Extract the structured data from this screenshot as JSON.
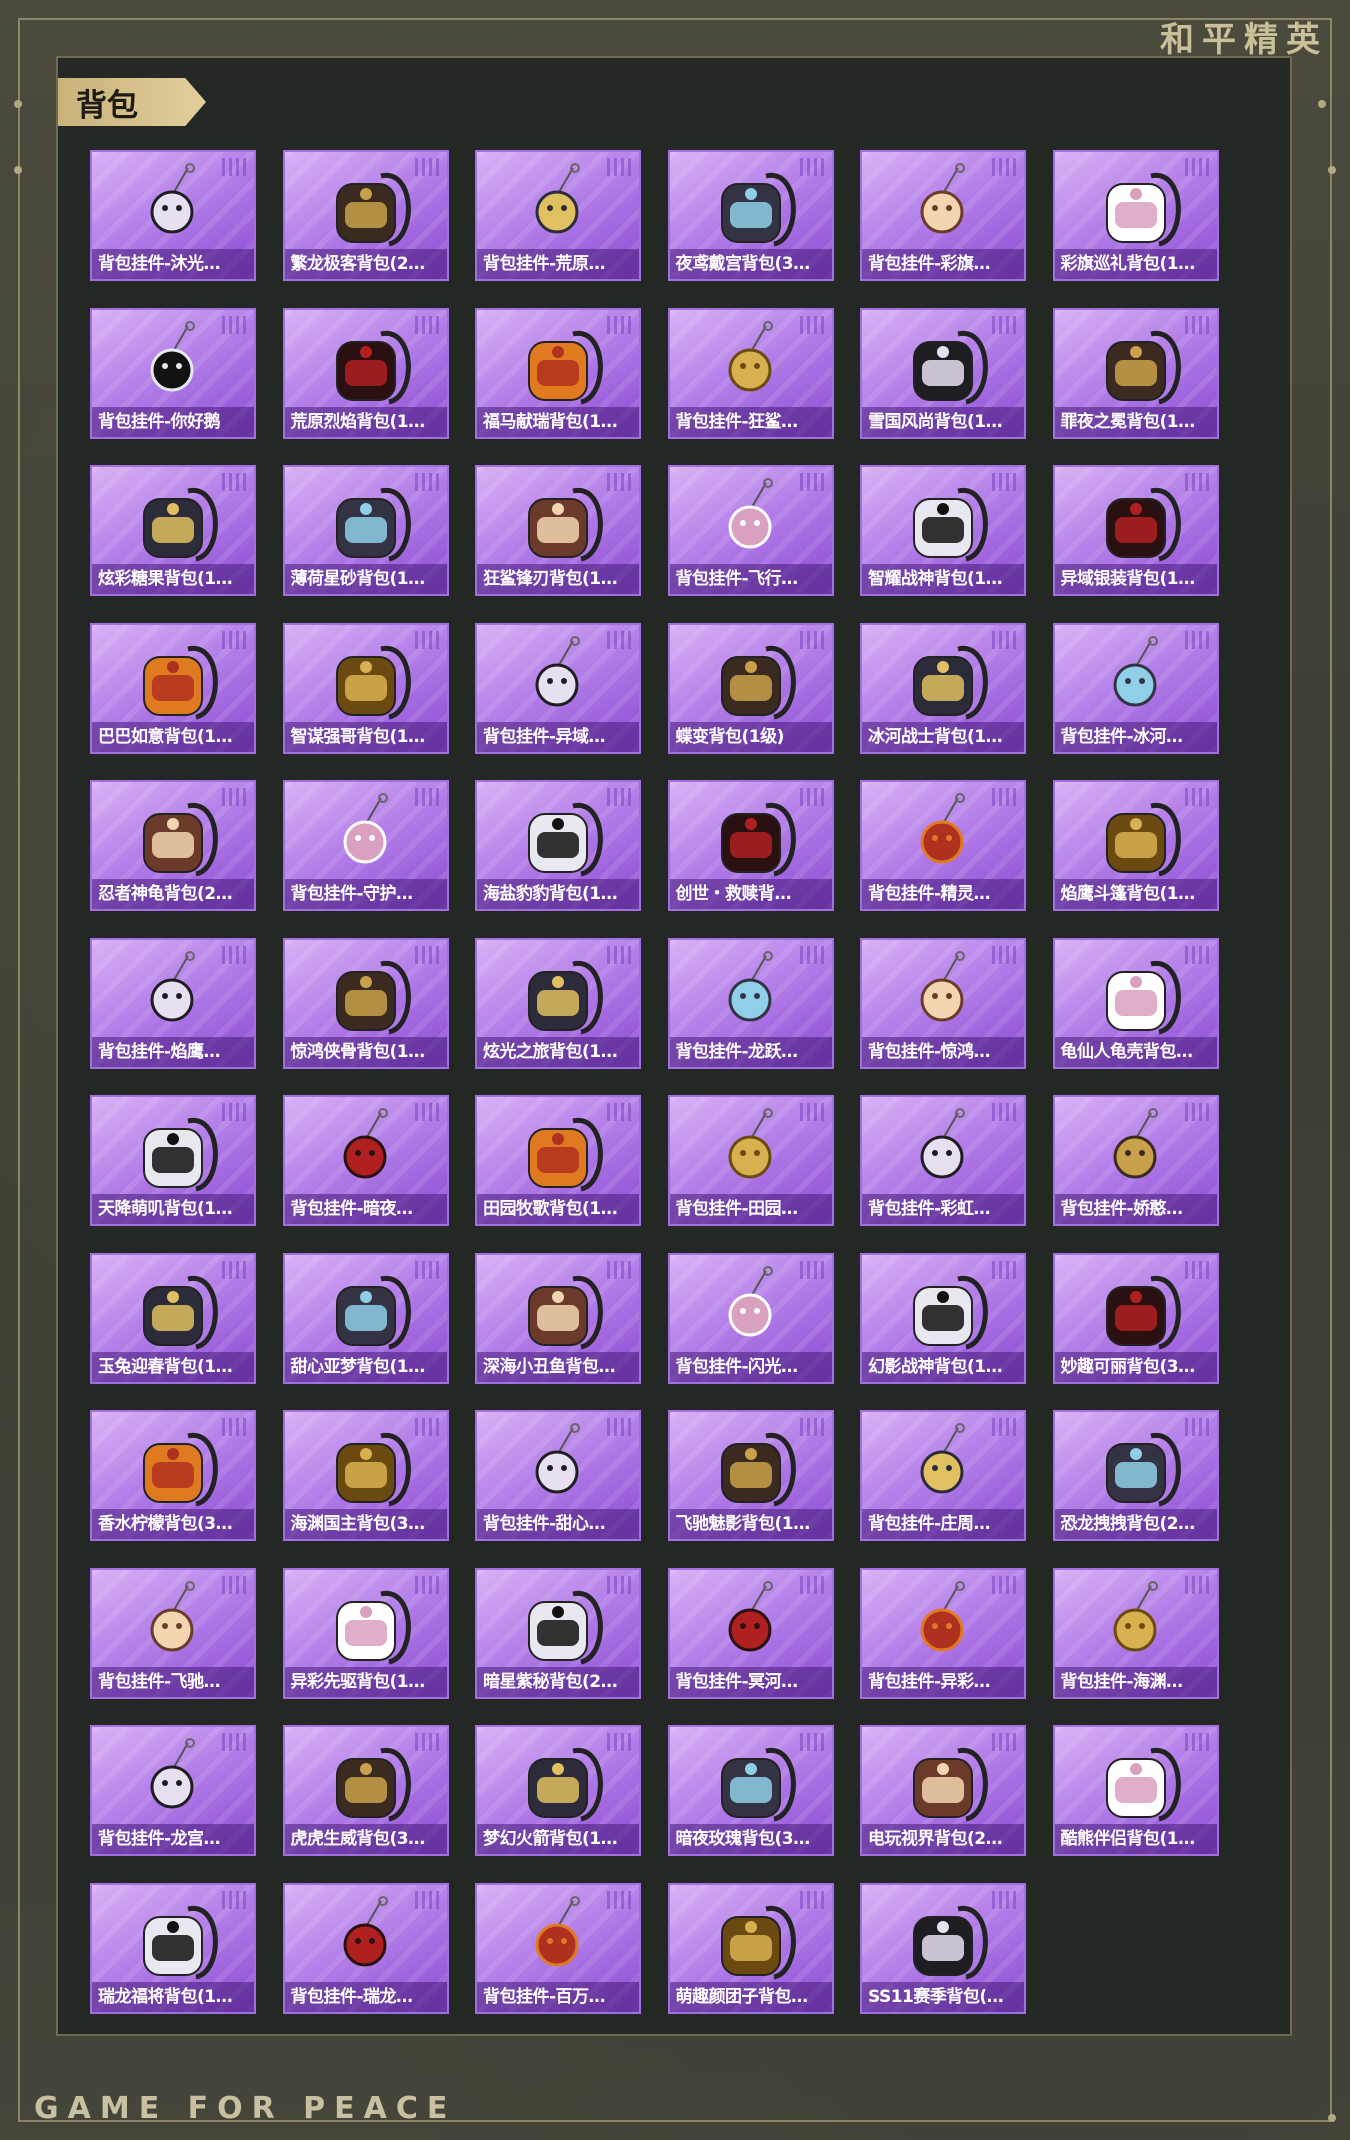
{
  "header": {
    "brand_cn": "和平精英",
    "brand_en": "GAME FOR PEACE"
  },
  "panel": {
    "title": "背包"
  },
  "colors": {
    "card_gradient_top": "#d9b2f6",
    "card_gradient_bottom": "#8d4bd3",
    "ribbon": "#c9b27a"
  },
  "items": [
    {
      "label": "背包挂件-沐光…",
      "icon": "cat-charm-icon"
    },
    {
      "label": "繁龙极客背包(2…",
      "icon": "black-gold-backpack-icon"
    },
    {
      "label": "背包挂件-荒原…",
      "icon": "star-charm-icon"
    },
    {
      "label": "夜鸢戴宫背包(3…",
      "icon": "jellyfish-backpack-icon"
    },
    {
      "label": "背包挂件-彩旗…",
      "icon": "ice-cream-charm-icon"
    },
    {
      "label": "彩旗巡礼背包(1…",
      "icon": "bunny-backpack-icon"
    },
    {
      "label": "背包挂件-你好鹅",
      "icon": "penguin-charm-icon"
    },
    {
      "label": "荒原烈焰背包(1…",
      "icon": "dark-red-backpack-icon"
    },
    {
      "label": "福马献瑞背包(1…",
      "icon": "orange-horse-backpack-icon"
    },
    {
      "label": "背包挂件-狂鲨…",
      "icon": "gold-feather-charm-icon"
    },
    {
      "label": "雪国风尚背包(1…",
      "icon": "snow-bunny-backpack-icon"
    },
    {
      "label": "罪夜之冕背包(1…",
      "icon": "black-bird-backpack-icon"
    },
    {
      "label": "炫彩糖果背包(1…",
      "icon": "donut-backpack-icon"
    },
    {
      "label": "薄荷星砂背包(1…",
      "icon": "mint-bag-icon"
    },
    {
      "label": "狂鲨锋刃背包(1…",
      "icon": "shark-backpack-icon"
    },
    {
      "label": "背包挂件-飞行…",
      "icon": "plane-charm-icon"
    },
    {
      "label": "智耀战神背包(1…",
      "icon": "rabbit-backpack-icon"
    },
    {
      "label": "异域银装背包(1…",
      "icon": "dark-case-backpack-icon"
    },
    {
      "label": "巴巴如意背包(1…",
      "icon": "white-bunny-backpack-icon"
    },
    {
      "label": "智谋强哥背包(1…",
      "icon": "bear-backpack-icon"
    },
    {
      "label": "背包挂件-异域…",
      "icon": "wing-charm-icon"
    },
    {
      "label": "蝶变背包(1级)",
      "icon": "black-bag-icon"
    },
    {
      "label": "冰河战士背包(1…",
      "icon": "blue-armor-backpack-icon"
    },
    {
      "label": "背包挂件-冰河…",
      "icon": "robot-charm-icon"
    },
    {
      "label": "忍者神龟背包(2…",
      "icon": "turtle-backpack-icon"
    },
    {
      "label": "背包挂件-守护…",
      "icon": "gem-charm-icon"
    },
    {
      "label": "海盐豹豹背包(1…",
      "icon": "seal-backpack-icon"
    },
    {
      "label": "创世・救赎背…",
      "icon": "mech-backpack-icon"
    },
    {
      "label": "背包挂件-精灵…",
      "icon": "heart-wing-charm-icon"
    },
    {
      "label": "焰鹰斗篷背包(1…",
      "icon": "red-cape-backpack-icon"
    },
    {
      "label": "背包挂件-焰鹰…",
      "icon": "knot-charm-icon"
    },
    {
      "label": "惊鸿侠骨背包(1…",
      "icon": "brown-backpack-icon"
    },
    {
      "label": "炫光之旅背包(1…",
      "icon": "arcade-backpack-icon"
    },
    {
      "label": "背包挂件-龙跃…",
      "icon": "lion-dance-charm-icon"
    },
    {
      "label": "背包挂件-惊鸿…",
      "icon": "tassel-charm-icon"
    },
    {
      "label": "龟仙人龟壳背包…",
      "icon": "shell-backpack-icon"
    },
    {
      "label": "天降萌叽背包(1…",
      "icon": "yellow-chick-backpack-icon"
    },
    {
      "label": "背包挂件-暗夜…",
      "icon": "dark-tassel-charm-icon"
    },
    {
      "label": "田园牧歌背包(1…",
      "icon": "basket-backpack-icon"
    },
    {
      "label": "背包挂件-田园…",
      "icon": "card-charm-icon"
    },
    {
      "label": "背包挂件-彩虹…",
      "icon": "flower-charm-icon"
    },
    {
      "label": "背包挂件-娇憨…",
      "icon": "pink-cloud-charm-icon"
    },
    {
      "label": "玉兔迎春背包(1…",
      "icon": "red-backpack-icon"
    },
    {
      "label": "甜心亚梦背包(1…",
      "icon": "cat-ear-backpack-icon"
    },
    {
      "label": "深海小丑鱼背包…",
      "icon": "clownfish-backpack-icon"
    },
    {
      "label": "背包挂件-闪光…",
      "icon": "claw-charm-icon"
    },
    {
      "label": "幻影战神背包(1…",
      "icon": "grey-armor-backpack-icon"
    },
    {
      "label": "妙趣可丽背包(3…",
      "icon": "gift-backpack-icon"
    },
    {
      "label": "香水柠檬背包(3…",
      "icon": "duck-backpack-icon"
    },
    {
      "label": "海渊国主背包(3…",
      "icon": "sea-king-backpack-icon"
    },
    {
      "label": "背包挂件-甜心…",
      "icon": "paw-charm-icon"
    },
    {
      "label": "飞驰魅影背包(1…",
      "icon": "white-helmet-backpack-icon"
    },
    {
      "label": "背包挂件-庄周…",
      "icon": "butterfly-charm-icon"
    },
    {
      "label": "恐龙拽拽背包(2…",
      "icon": "dino-backpack-icon"
    },
    {
      "label": "背包挂件-飞驰…",
      "icon": "winged-eye-charm-icon"
    },
    {
      "label": "异彩先驱背包(1…",
      "icon": "pink-pig-backpack-icon"
    },
    {
      "label": "暗星紫秘背包(2…",
      "icon": "purple-gold-backpack-icon"
    },
    {
      "label": "背包挂件-冥河…",
      "icon": "pharaoh-charm-icon"
    },
    {
      "label": "背包挂件-异彩…",
      "icon": "skate-charm-icon"
    },
    {
      "label": "背包挂件-海渊…",
      "icon": "fairy-charm-icon"
    },
    {
      "label": "背包挂件-龙宫…",
      "icon": "jade-charm-icon"
    },
    {
      "label": "虎虎生威背包(3…",
      "icon": "tiger-backpack-icon"
    },
    {
      "label": "梦幻火箭背包(1…",
      "icon": "rocket-backpack-icon"
    },
    {
      "label": "暗夜玫瑰背包(3…",
      "icon": "doll-backpack-icon"
    },
    {
      "label": "电玩视界背包(2…",
      "icon": "game-box-backpack-icon"
    },
    {
      "label": "酷熊伴侣背包(1…",
      "icon": "cool-bear-backpack-icon"
    },
    {
      "label": "瑞龙福将背包(1…",
      "icon": "red-dragon-backpack-icon"
    },
    {
      "label": "背包挂件-瑞龙…",
      "icon": "lantern-charm-icon"
    },
    {
      "label": "背包挂件-百万…",
      "icon": "alien-charm-icon"
    },
    {
      "label": "萌趣颜团子背包…",
      "icon": "dumpling-backpack-icon"
    },
    {
      "label": "SS11赛季背包(…",
      "icon": "season-backpack-icon"
    }
  ]
}
